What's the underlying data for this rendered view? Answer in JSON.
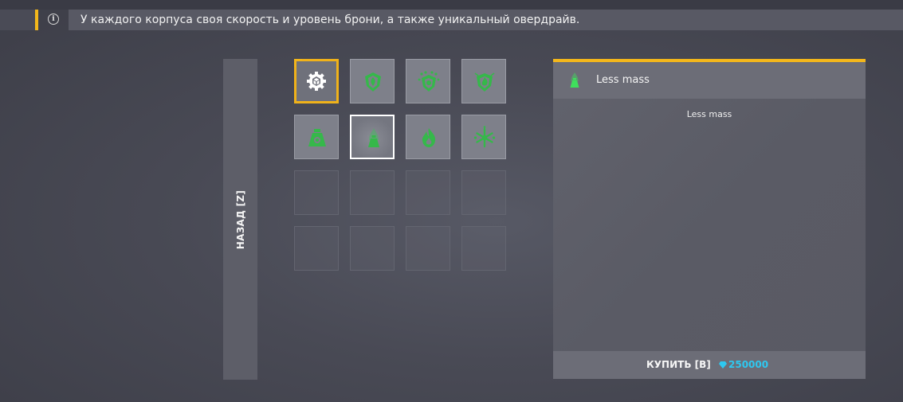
{
  "notice": {
    "text": "У каждого корпуса своя скорость и уровень брони, а также уникальный овердрайв.",
    "icon": "info-icon"
  },
  "back_button": {
    "label": "НАЗАД [Z]"
  },
  "grid": {
    "items": [
      {
        "icon": "gear-cube-icon",
        "state": "active"
      },
      {
        "icon": "armor-shield-icon",
        "state": "filled"
      },
      {
        "icon": "freeze-shield-icon",
        "state": "filled"
      },
      {
        "icon": "fire-shield-icon",
        "state": "filled"
      },
      {
        "icon": "weight-icon",
        "state": "filled"
      },
      {
        "icon": "less-mass-icon",
        "state": "selected"
      },
      {
        "icon": "flame-icon",
        "state": "filled"
      },
      {
        "icon": "snowflake-icon",
        "state": "filled"
      },
      {
        "state": "empty"
      },
      {
        "state": "empty"
      },
      {
        "state": "empty"
      },
      {
        "state": "empty"
      },
      {
        "state": "empty"
      },
      {
        "state": "empty"
      },
      {
        "state": "empty"
      },
      {
        "state": "empty"
      }
    ]
  },
  "detail": {
    "title": "Less mass",
    "description": "Less mass",
    "icon": "less-mass-icon"
  },
  "buy": {
    "label": "КУПИТЬ [B]",
    "price": "250000",
    "currency_icon": "crystal-icon"
  },
  "colors": {
    "accent": "#f3b71b",
    "icon_green": "#35b84a",
    "price_blue": "#2ec8f0"
  }
}
